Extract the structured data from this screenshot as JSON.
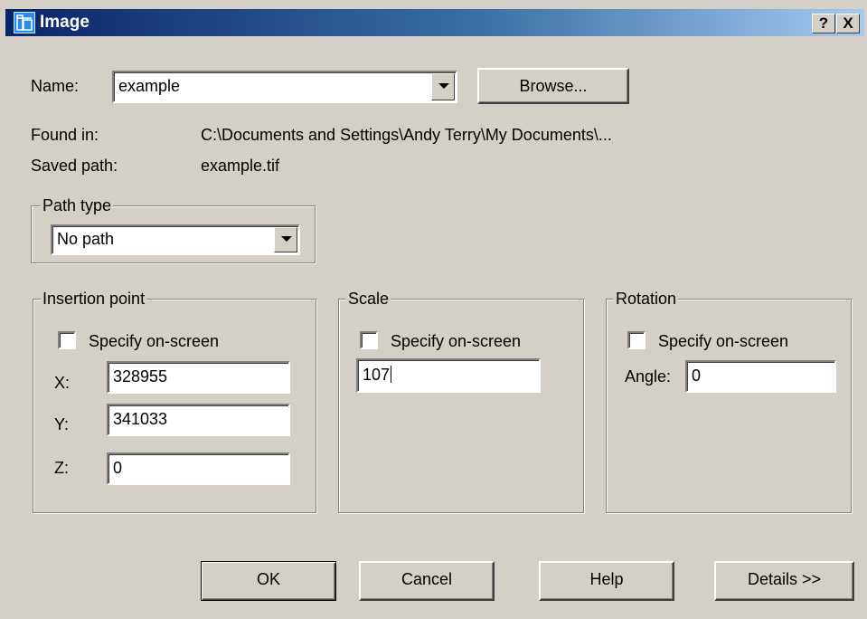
{
  "window": {
    "title": "Image",
    "help_button": "?",
    "close_button": "X"
  },
  "name_row": {
    "label": "Name:",
    "value": "example",
    "browse_label": "Browse..."
  },
  "info": {
    "found_in_label": "Found in:",
    "found_in_value": "C:\\Documents and Settings\\Andy Terry\\My Documents\\...",
    "saved_path_label": "Saved path:",
    "saved_path_value": "example.tif"
  },
  "path_type": {
    "group_label": "Path type",
    "selected": "No path"
  },
  "insertion_point": {
    "group_label": "Insertion point",
    "specify_label": "Specify on-screen",
    "specify_checked": false,
    "x_label": "X:",
    "x_value": "328955",
    "y_label": "Y:",
    "y_value": "341033",
    "z_label": "Z:",
    "z_value": "0"
  },
  "scale": {
    "group_label": "Scale",
    "specify_label": "Specify on-screen",
    "specify_checked": false,
    "value": "107"
  },
  "rotation": {
    "group_label": "Rotation",
    "specify_label": "Specify on-screen",
    "specify_checked": false,
    "angle_label": "Angle:",
    "angle_value": "0"
  },
  "buttons": {
    "ok": "OK",
    "cancel": "Cancel",
    "help": "Help",
    "details": "Details >>"
  },
  "colors": {
    "dialog_bg": "#d4d0c8",
    "title_start": "#0a246a",
    "title_end": "#a6caf0"
  },
  "icons": {
    "title": "image-app-icon",
    "dropdown": "chevron-down-icon"
  }
}
